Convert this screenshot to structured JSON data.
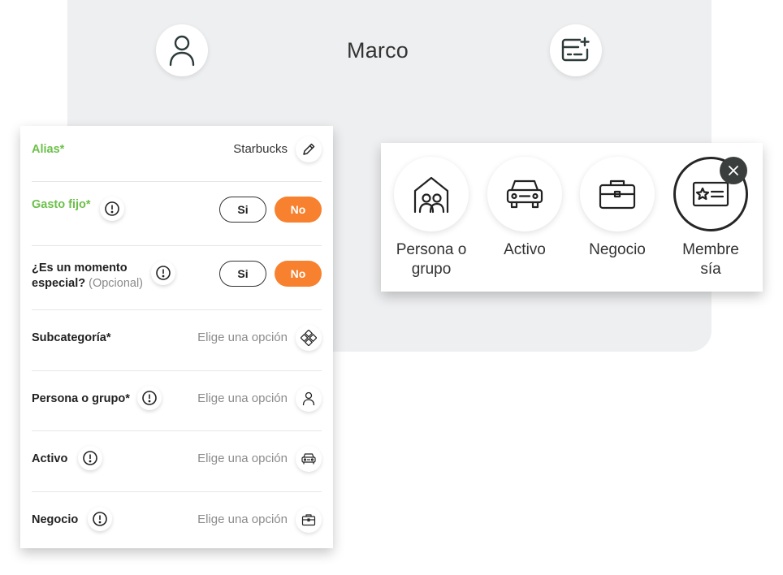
{
  "header": {
    "user_name": "Marco",
    "profile_icon": "user-icon",
    "add_card_icon": "add-card-icon"
  },
  "form": {
    "rows": [
      {
        "label": "Alias*",
        "value": "Starbucks",
        "icon": "pencil-icon"
      },
      {
        "label": "Gasto fijo*",
        "toggle": {
          "yes": "Si",
          "no": "No",
          "selected": "No"
        }
      },
      {
        "label_line1": "¿Es un momento",
        "label_line2": "especial?",
        "label_optional": "(Opcional)",
        "toggle": {
          "yes": "Si",
          "no": "No",
          "selected": "No"
        }
      },
      {
        "label": "Subcategoría*",
        "value": "Elige una opción",
        "icon": "categories-icon"
      },
      {
        "label": "Persona o grupo*",
        "value": "Elige una opción",
        "icon": "user-icon"
      },
      {
        "label": "Activo",
        "value": "Elige una opción",
        "icon": "car-icon"
      },
      {
        "label": "Negocio",
        "value": "Elige una opción",
        "icon": "briefcase-icon"
      }
    ]
  },
  "popup": {
    "options": [
      {
        "line1": "Persona o",
        "line2": "grupo",
        "icon": "group-home-icon"
      },
      {
        "line1": "Activo",
        "line2": "",
        "icon": "car-icon"
      },
      {
        "line1": "Negocio",
        "line2": "",
        "icon": "briefcase-icon"
      },
      {
        "line1": "Membre",
        "line2": "sía",
        "icon": "membership-card-icon",
        "selected": true
      }
    ],
    "close_icon": "close-icon"
  },
  "colors": {
    "accent_orange": "#f7812e",
    "label_green": "#6cc04a",
    "background_panel": "#eeeff0"
  }
}
